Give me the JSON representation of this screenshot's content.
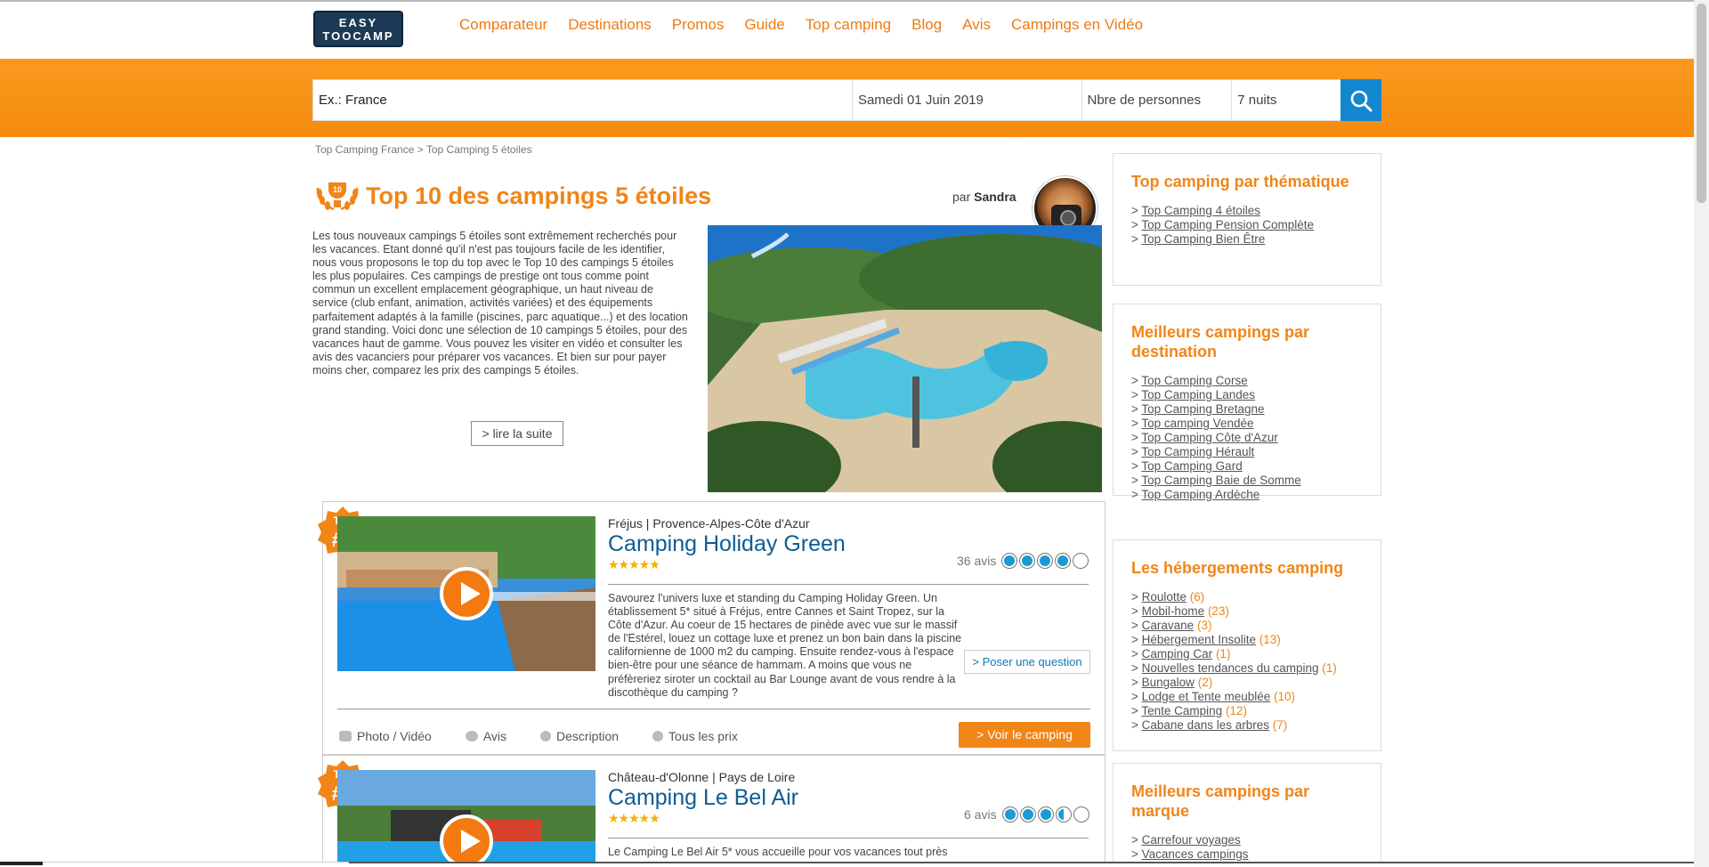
{
  "header": {
    "logo_line1": "EASY",
    "logo_line2": "TOOCAMP",
    "nav": [
      "Comparateur",
      "Destinations",
      "Promos",
      "Guide",
      "Top camping",
      "Blog",
      "Avis",
      "Campings en Vidéo"
    ]
  },
  "search": {
    "destination": "Ex.: France",
    "date": "Samedi 01 Juin 2019",
    "persons": "Nbre de personnes",
    "nights": "7 nuits"
  },
  "breadcrumb": {
    "level1": "Top Camping France",
    "separator": " > ",
    "level2": "Top Camping 5 étoiles"
  },
  "page": {
    "laurel_number": "10",
    "title": "Top 10 des campings 5 étoiles",
    "author_prefix": "par ",
    "author": "Sandra",
    "intro": "Les tous nouveaux campings 5 étoiles sont extrêmement recherchés pour les vacances. Etant donné qu'il n'est pas toujours facile de les identifier, nous vous proposons le top du top avec le Top 10 des campings 5 étoiles les plus populaires. Ces campings de prestige ont tous comme point commun un excellent emplacement géographique, un haut niveau de service (club enfant, animation, activités variées) et des équipements parfaitement adaptés à la famille (piscines, parc aquatique...) et des location grand standing. Voici donc une sélection de 10 campings 5 étoiles, pour des vacances haut de gamme. Vous pouvez les visiter en vidéo et consulter les avis des vacanciers pour préparer vos vacances. Et bien sur pour payer moins cher, comparez les prix des campings 5 étoiles.",
    "read_more": "> lire la suite"
  },
  "listings": [
    {
      "badge_top": "Top",
      "badge_rank": "#1",
      "city": "Fréjus",
      "region": "Provence-Alpes-Côte d'Azur",
      "name": "Camping Holiday Green",
      "stars": "★★★★★",
      "reviews": "36 avis",
      "rating": 4,
      "description": "Savourez l'univers luxe et standing du Camping Holiday Green. Un établissement 5* situé à Fréjus, entre Cannes et Saint Tropez, sur la Côte d'Azur. Au coeur de 15 hectares de pinède avec vue sur le massif de l'Estérel, louez un cottage luxe et prenez un bon bain dans la piscine californienne de 1000 m2 du camping. Ensuite rendez-vous à l'espace bien-être pour une séance de hammam. A moins que vous ne préfèreriez siroter un cocktail au Bar Lounge avant de vous rendre à la discothèque du camping ?",
      "ask": "> Poser une question",
      "tabs": [
        "Photo / Vidéo",
        "Avis",
        "Description",
        "Tous les prix"
      ],
      "cta": "> Voir le camping"
    },
    {
      "badge_top": "Top",
      "badge_rank": "#2",
      "city": "Château-d'Olonne",
      "region": "Pays de Loire",
      "name": "Camping Le Bel Air",
      "stars": "★★★★★",
      "reviews": "6 avis",
      "rating": 3.5,
      "description": "Le Camping Le Bel Air 5* vous accueille pour vos vacances tout près"
    }
  ],
  "sidebar": [
    {
      "title": "Top camping par thématique",
      "items": [
        {
          "label": "Top Camping 4 étoiles"
        },
        {
          "label": "Top Camping Pension Complète"
        },
        {
          "label": "Top Camping Bien Être"
        }
      ]
    },
    {
      "title": "Meilleurs campings par destination",
      "items": [
        {
          "label": "Top Camping Corse"
        },
        {
          "label": "Top Camping Landes"
        },
        {
          "label": "Top Camping Bretagne"
        },
        {
          "label": "Top camping Vendée"
        },
        {
          "label": "Top Camping Côte d'Azur"
        },
        {
          "label": "Top Camping Hérault"
        },
        {
          "label": "Top Camping Gard"
        },
        {
          "label": "Top Camping Baie de Somme"
        },
        {
          "label": "Top Camping Ardèche"
        }
      ]
    },
    {
      "title": "Les hébergements camping",
      "items": [
        {
          "label": "Roulotte",
          "count": "(6)"
        },
        {
          "label": "Mobil-home",
          "count": "(23)"
        },
        {
          "label": "Caravane",
          "count": "(3)"
        },
        {
          "label": "Hébergement Insolite",
          "count": "(13)"
        },
        {
          "label": "Camping Car",
          "count": "(1)"
        },
        {
          "label": "Nouvelles tendances du camping",
          "count": "(1)"
        },
        {
          "label": "Bungalow",
          "count": "(2)"
        },
        {
          "label": "Lodge et Tente meublée",
          "count": "(10)"
        },
        {
          "label": "Tente Camping",
          "count": "(12)"
        },
        {
          "label": "Cabane dans les arbres",
          "count": "(7)"
        }
      ]
    },
    {
      "title": "Meilleurs campings par marque",
      "items": [
        {
          "label": "Carrefour voyages"
        },
        {
          "label": "Vacances campings"
        }
      ]
    }
  ],
  "colors": {
    "accent": "#f08518",
    "brand_blue": "#0f5c94",
    "search_button": "#1487d0",
    "rating": "#1a9bd4"
  },
  "icons": {
    "search": "search-icon",
    "play": "play-icon",
    "laurel": "laurel-icon"
  }
}
